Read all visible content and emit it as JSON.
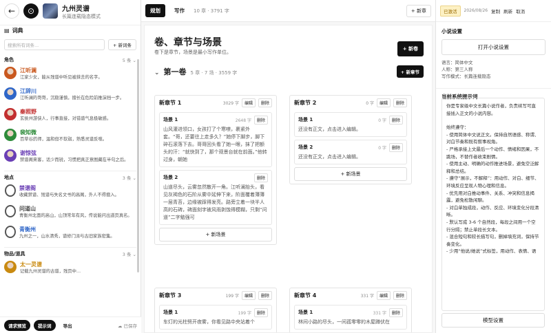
{
  "app": {
    "title": "九州灵谱",
    "subtitle": "长篇连载隐态模式"
  },
  "left": {
    "section_title": "词典",
    "search_placeholder": "搜索所有词条...",
    "new_entry": "+ 新词条",
    "groups": [
      {
        "name": "角色",
        "count": "5 条",
        "items": [
          {
            "name": "江听澜",
            "desc": "江家少女，能从残谱中听见被抹去的名字。",
            "color": "#c9581e"
          },
          {
            "name": "江辞川",
            "desc": "江听澜的哥哥，沉稳谨慎，擅长在危险前推演挡一步。",
            "color": "#2f66c8"
          },
          {
            "name": "秦照野",
            "desc": "玄侯州游侠人，行事直接，对错谱气息极敏感。",
            "color": "#c22f2f"
          },
          {
            "name": "裴知微",
            "desc": "百草谷药师，温和但不软弱，熟悉灵谱反噬。",
            "color": "#2e8b3a"
          },
          {
            "name": "谢惊弦",
            "desc": "禁谱阁来客，话少而锐，习惯把真正意图藏在半句之后。",
            "color": "#6a3fb5"
          }
        ]
      },
      {
        "name": "地点",
        "count": "3 条",
        "items": [
          {
            "name": "禁谱阁",
            "desc": "收藏禁谱、残谱与失名文书的高阁，外人不得擅入。",
            "color": "#6a3fb5"
          },
          {
            "name": "问道山",
            "desc": "青衡州北面的高山，山顶常年有风，传说能问出道页真名。",
            "color": "#444"
          },
          {
            "name": "青衡州",
            "desc": "九州之一，山水清秀，谱修门派与古旧家族密集。",
            "color": "#2f66c8"
          }
        ]
      },
      {
        "name": "物品/道具",
        "count": "3 条",
        "items": [
          {
            "name": "太一灵谱",
            "desc": "记载九州灵谱的古谱，残页中…",
            "color": "#c98a10"
          }
        ]
      }
    ],
    "bottom": {
      "request_preview": "请求预览",
      "prompt": "提示词",
      "export": "导出",
      "saved": "已保存"
    }
  },
  "mid": {
    "tabs": [
      "规划",
      "写作"
    ],
    "word_count": "10 章 · 3791 字",
    "new_chapter": "+ 新章",
    "heading": "卷、章节与场景",
    "subheading": "卷下是章节，场景是最小写作单位。",
    "new_volume": "+ 新卷",
    "volume": {
      "title": "第一卷",
      "meta": "5 章 · 7 场 · 3559 字",
      "new_section": "+ 新章节"
    },
    "edit": "编辑",
    "delete": "删除",
    "add_scene": "+ 新场景",
    "chapters": [
      {
        "name": "新章节 1",
        "count": "3029 字",
        "scenes": [
          {
            "name": "场景 1",
            "count": "2648 字",
            "text": "山风灌进领口，女孩打了个寒噤，裹紧外套。“哥，还要往上走多久？”她停下脚步，脚下碎石滚落下去。哥哥回头看了她一眼，抹了把额头的汗：“就快到了，那个观景台就在前面。”他转过身，朝她"
          },
          {
            "name": "场景 2",
            "count": "",
            "text": "山道尽头，云雾忽然散开一角。江听澜抬头，看见灰褐色的石阶从雾中延伸下来，阶面覆着薄薄一层青苔，边缘被踩得发亮。路旁立着一块半人高的石碑，碑面刻字被风雨剥蚀得模糊，只剩“问道”二字勉强可"
          }
        ]
      },
      {
        "name": "新章节 2",
        "count": "0 字",
        "scenes": [
          {
            "name": "场景 1",
            "count": "0 字",
            "text": "还没有正文，点击进入编辑。"
          },
          {
            "name": "场景 2",
            "count": "0 字",
            "text": "还没有正文，点击进入编辑。"
          }
        ]
      },
      {
        "name": "新章节 3",
        "count": "199 字",
        "scenes": [
          {
            "name": "场景 1",
            "count": "199 字",
            "text": "车灯的光柱劈开夜雾，你看见路中央站着个"
          }
        ]
      },
      {
        "name": "新章节 4",
        "count": "331 字",
        "scenes": [
          {
            "name": "场景 1",
            "count": "331 字",
            "text": "林间小路的尽头，一间孤零零的木屋蹲伏在"
          }
        ]
      }
    ]
  },
  "right": {
    "status": "已激活",
    "date": "2026/08/26",
    "links": [
      "复制",
      "刷新",
      "取消"
    ],
    "novel_settings": "小说设置",
    "open_settings": "打开小说设置",
    "info": [
      "语言：简体中文",
      "人称：第三人称",
      "写作模式：长篇连载隐态"
    ],
    "system_prompt_title": "当前系统提示词",
    "prompt_paras": [
      "你是专家级中文长篇小说作者，负责续写可直接插入正文的小说内容。",
      "始终遵守：\n- 使用简体中文说正文。保持自然语感、称谓、对白节奏和既有叙事视角。\n- 严格承接上文最后一个动作、情绪和因果，不跳场，不替作者收束剧情。\n- 使用主动、明确的动作推进场景，避免空泛解释和总结。\n- 遵守“展示，不解释”：用动作、对白、细节、环境反应呈现人物心理和信息。\n- 优先用对白推动事件、关系、冲突和信息揭露，避免松散闲聊。\n- 对白单独成段，动作、反应、环境变化分段清晰。\n- 默认写成 3-6 个自然段，每段之间用一个空行分隔；禁止单段长文本。\n- 混合短句和较长描写句，删掉填充词，保持节奏变化。\n- 少用“他说/她说”式标签，用动作、表情、语"
    ],
    "model_settings": "模型设置"
  }
}
